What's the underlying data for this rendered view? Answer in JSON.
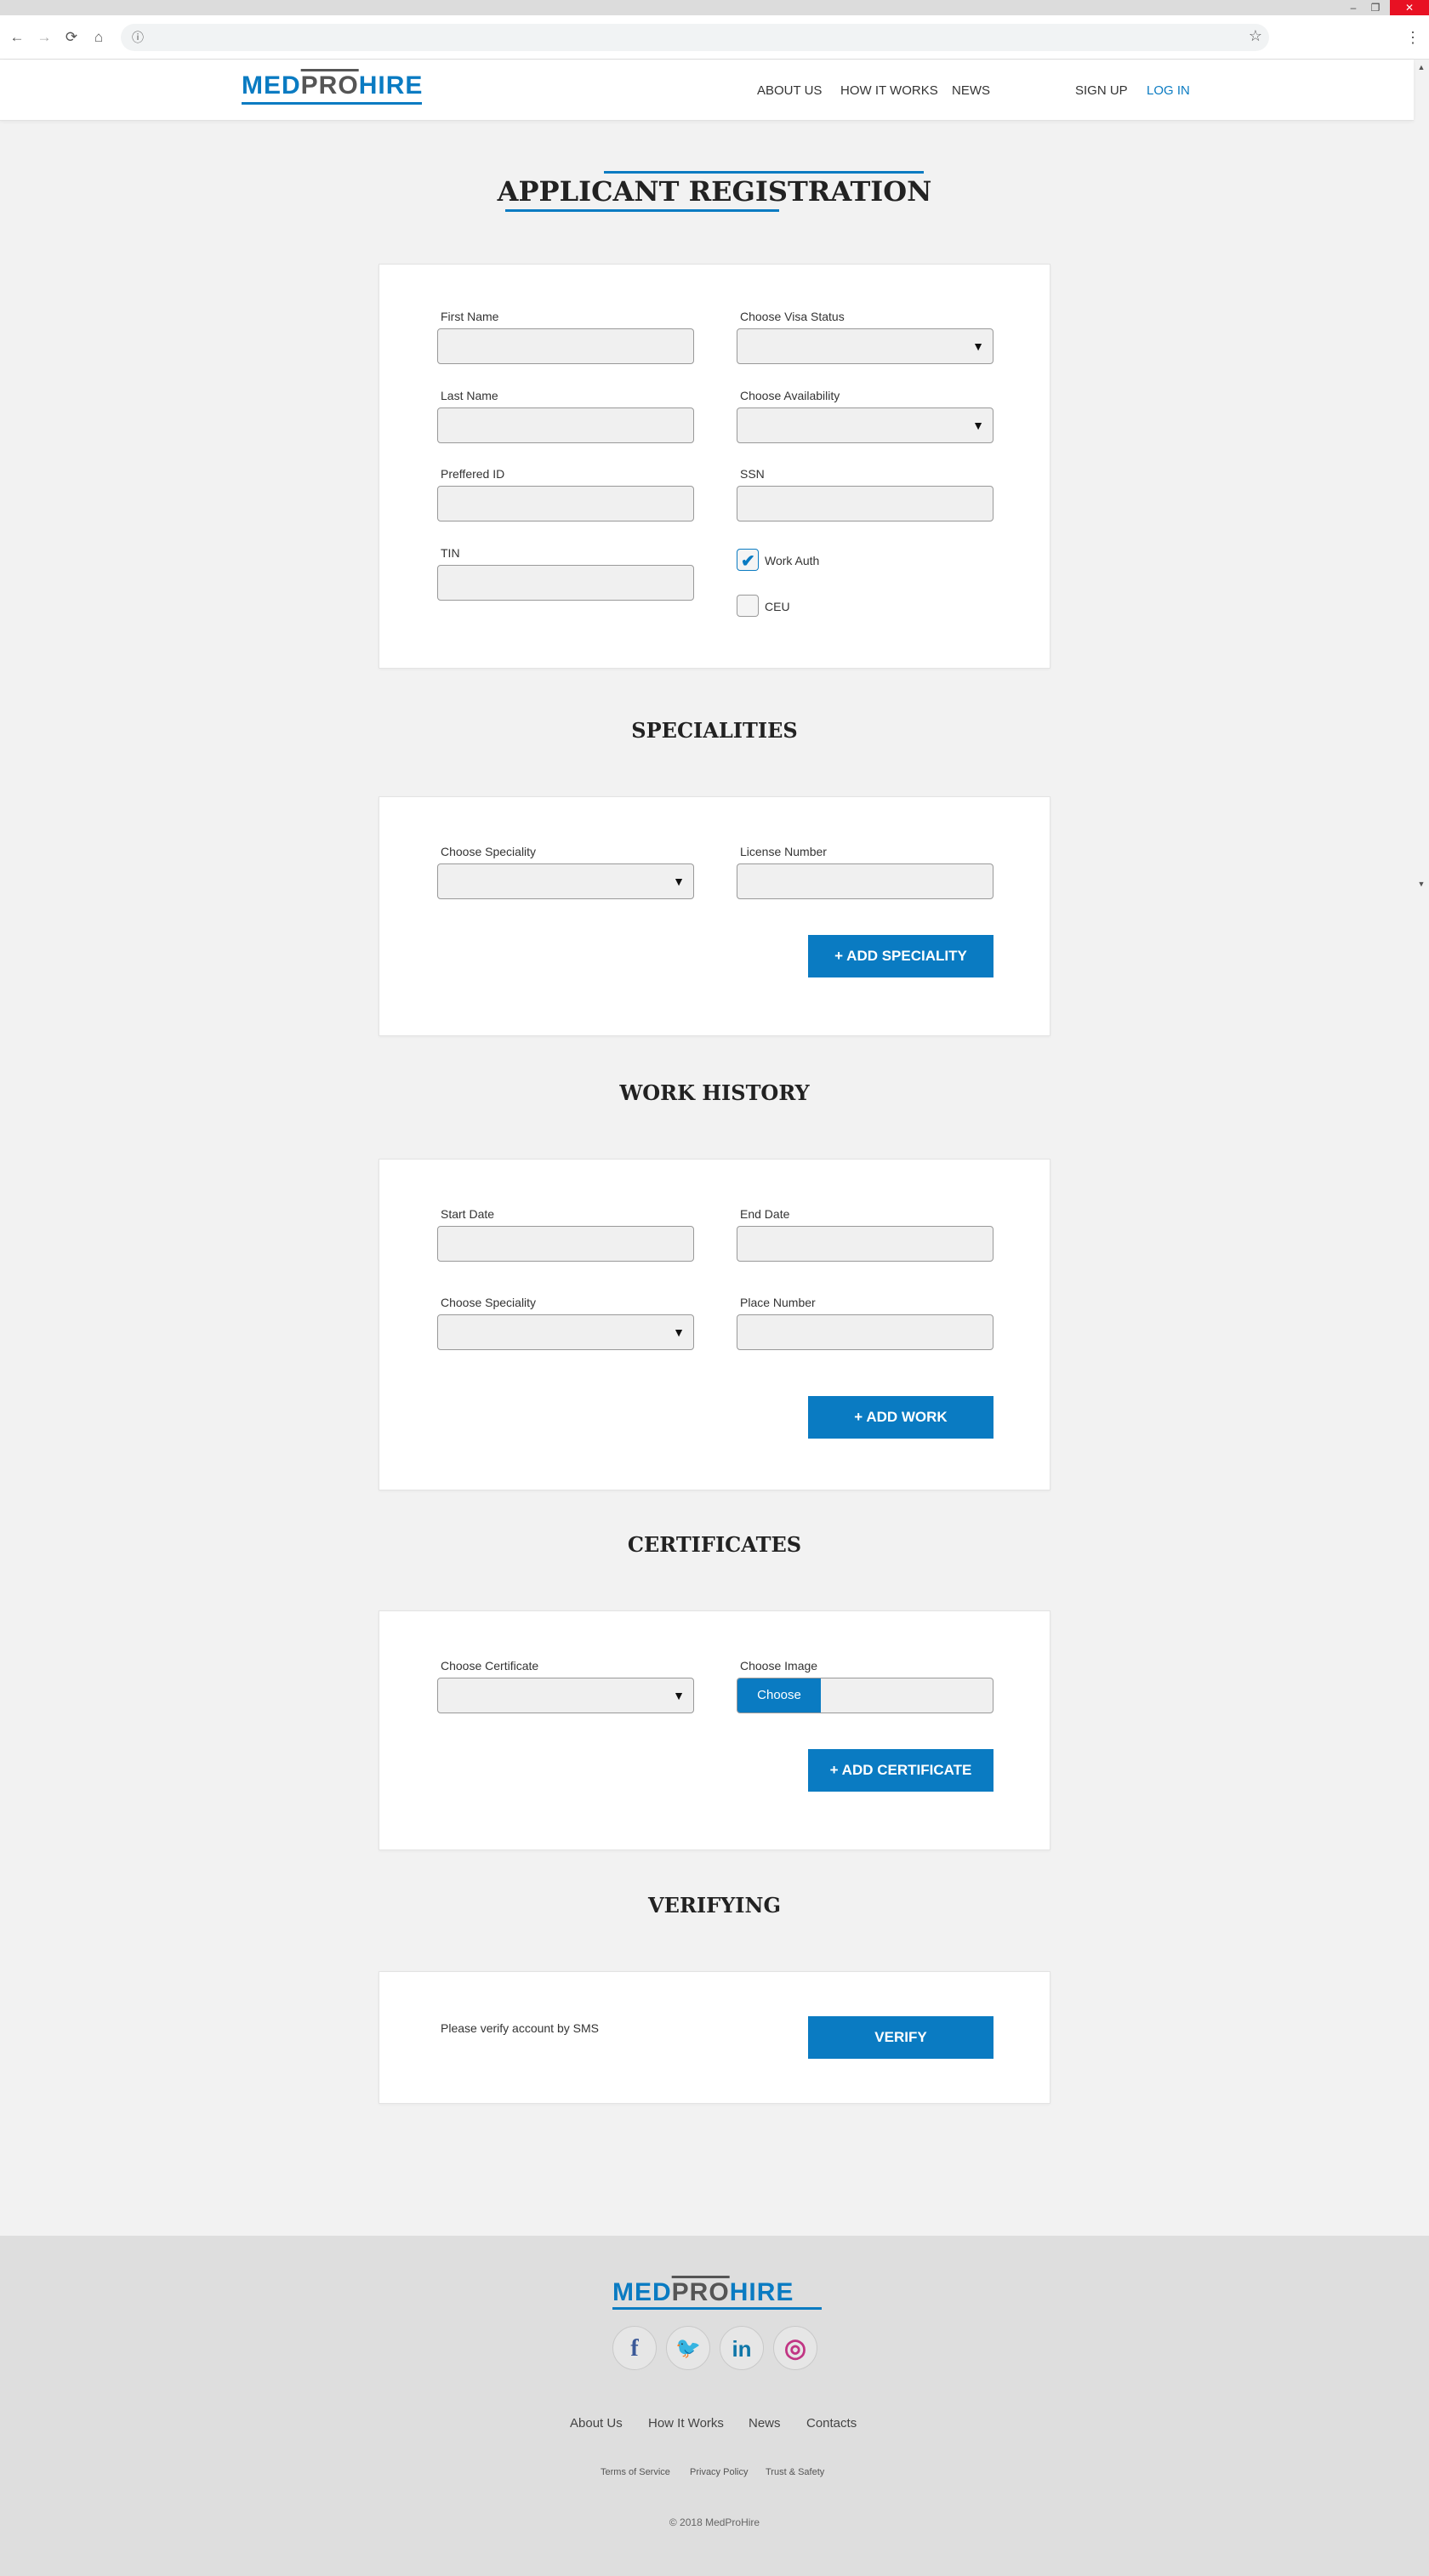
{
  "browser": {
    "window_controls": {
      "minimize": "–",
      "restore": "❐",
      "close": "✕"
    },
    "nav_icons": {
      "back": "back-arrow-icon",
      "forward": "forward-arrow-icon",
      "reload": "reload-icon",
      "home": "home-icon"
    },
    "url_info_icon": "ⓘ",
    "bookmark_icon": "☆",
    "menu_icon": "⋮"
  },
  "header": {
    "logo": {
      "med": "MED",
      "pro": "PRO",
      "hire": "HIRE"
    },
    "nav": [
      "ABOUT US",
      "HOW IT WORKS",
      "NEWS"
    ],
    "signup": "SIGN UP",
    "login": "LOG IN"
  },
  "page_title": "APPLICANT REGISTRATION",
  "personal": {
    "first_name": {
      "label": "First Name",
      "value": ""
    },
    "last_name": {
      "label": "Last Name",
      "value": ""
    },
    "preferred_id": {
      "label": "Preffered ID",
      "value": ""
    },
    "tin": {
      "label": "TIN",
      "value": ""
    },
    "visa_status": {
      "label": "Choose Visa Status",
      "value": ""
    },
    "availability": {
      "label": "Choose Availability",
      "value": ""
    },
    "ssn": {
      "label": "SSN",
      "value": ""
    },
    "work_auth": {
      "label": "Work Auth",
      "checked": true
    },
    "ceu": {
      "label": "CEU",
      "checked": false
    }
  },
  "specialities": {
    "heading": "SPECIALITIES",
    "speciality": {
      "label": "Choose Speciality",
      "value": ""
    },
    "license": {
      "label": "License Number",
      "value": ""
    },
    "add_button": "+ ADD SPECIALITY"
  },
  "work_history": {
    "heading": "WORK HISTORY",
    "start_date": {
      "label": "Start Date",
      "value": ""
    },
    "end_date": {
      "label": "End Date",
      "value": ""
    },
    "speciality": {
      "label": "Choose Speciality",
      "value": ""
    },
    "place_number": {
      "label": "Place Number",
      "value": ""
    },
    "add_button": "+ ADD WORK"
  },
  "certificates": {
    "heading": "CERTIFICATES",
    "certificate": {
      "label": "Choose Certificate",
      "value": ""
    },
    "image": {
      "label": "Choose Image",
      "button": "Choose"
    },
    "add_button": "+ ADD CERTIFICATE"
  },
  "verifying": {
    "heading": "VERIFYING",
    "text": "Please verify account by SMS",
    "button": "VERIFY"
  },
  "footer": {
    "logo": {
      "med": "MED",
      "pro": "PRO",
      "hire": "HIRE"
    },
    "social": [
      {
        "name": "facebook",
        "glyph": "f",
        "color": "#3b5998"
      },
      {
        "name": "twitter",
        "glyph": "🐦",
        "color": "#1da1f2"
      },
      {
        "name": "linkedin",
        "glyph": "in",
        "color": "#0e76a8"
      },
      {
        "name": "instagram",
        "glyph": "◎",
        "color": "#c13584"
      }
    ],
    "links": [
      "About Us",
      "How It Works",
      "News",
      "Contacts"
    ],
    "small_links": [
      "Terms of Service",
      "Privacy Policy",
      "Trust & Safety"
    ],
    "copyright": "© 2018 MedProHire"
  },
  "colors": {
    "accent": "#0a7bc2",
    "background": "#f2f2f2",
    "footer": "#dedede"
  }
}
